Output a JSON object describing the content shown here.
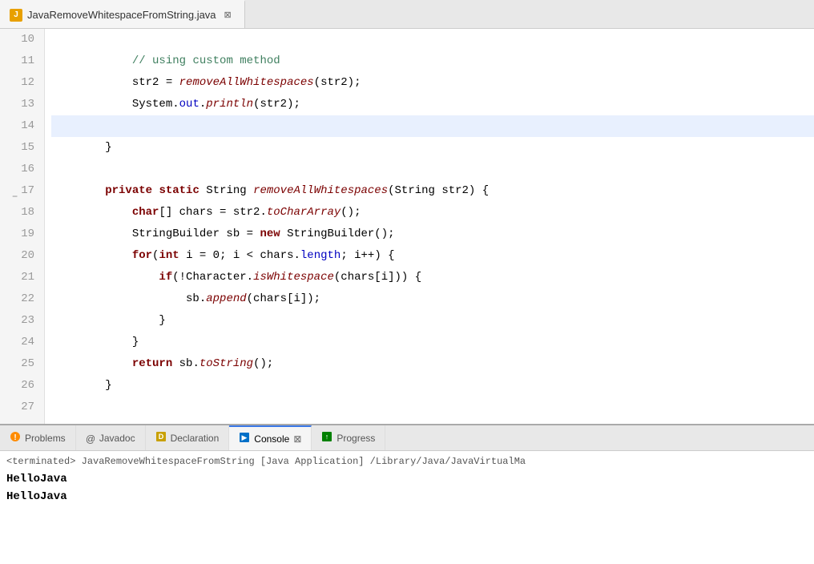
{
  "titlebar": {
    "tab_label": "JavaRemoveWhitespaceFromString.java",
    "tab_close": "✕"
  },
  "editor": {
    "lines": [
      {
        "num": "10",
        "content": "",
        "fold": false,
        "highlighted": false
      },
      {
        "num": "11",
        "content": "            // using custom method",
        "fold": false,
        "highlighted": false
      },
      {
        "num": "12",
        "content": "            str2 = removeAllWhitespaces(str2);",
        "fold": false,
        "highlighted": false
      },
      {
        "num": "13",
        "content": "            System.out.println(str2);",
        "fold": false,
        "highlighted": false
      },
      {
        "num": "14",
        "content": "",
        "fold": false,
        "highlighted": true
      },
      {
        "num": "15",
        "content": "        }",
        "fold": false,
        "highlighted": false
      },
      {
        "num": "16",
        "content": "",
        "fold": false,
        "highlighted": false
      },
      {
        "num": "17",
        "content": "        private static String removeAllWhitespaces(String str2) {",
        "fold": true,
        "highlighted": false
      },
      {
        "num": "18",
        "content": "            char[] chars = str2.toCharArray();",
        "fold": false,
        "highlighted": false
      },
      {
        "num": "19",
        "content": "            StringBuilder sb = new StringBuilder();",
        "fold": false,
        "highlighted": false
      },
      {
        "num": "20",
        "content": "            for(int i = 0; i < chars.length; i++) {",
        "fold": false,
        "highlighted": false
      },
      {
        "num": "21",
        "content": "                if(!Character.isWhitespace(chars[i])) {",
        "fold": false,
        "highlighted": false
      },
      {
        "num": "22",
        "content": "                    sb.append(chars[i]);",
        "fold": false,
        "highlighted": false
      },
      {
        "num": "23",
        "content": "                }",
        "fold": false,
        "highlighted": false
      },
      {
        "num": "24",
        "content": "            }",
        "fold": false,
        "highlighted": false
      },
      {
        "num": "25",
        "content": "            return sb.toString();",
        "fold": false,
        "highlighted": false
      },
      {
        "num": "26",
        "content": "        }",
        "fold": false,
        "highlighted": false
      },
      {
        "num": "27",
        "content": "",
        "fold": false,
        "highlighted": false
      }
    ]
  },
  "bottom_panel": {
    "tabs": [
      {
        "id": "problems",
        "label": "Problems",
        "icon": "⚠",
        "active": false
      },
      {
        "id": "javadoc",
        "label": "Javadoc",
        "icon": "@",
        "active": false
      },
      {
        "id": "declaration",
        "label": "Declaration",
        "icon": "📄",
        "active": false
      },
      {
        "id": "console",
        "label": "Console",
        "icon": "🖥",
        "active": true
      },
      {
        "id": "progress",
        "label": "Progress",
        "icon": "📊",
        "active": false
      }
    ],
    "console": {
      "terminated_text": "<terminated> JavaRemoveWhitespaceFromString [Java Application] /Library/Java/JavaVirtualMa",
      "output_lines": [
        "HelloJava",
        "HelloJava"
      ]
    }
  }
}
